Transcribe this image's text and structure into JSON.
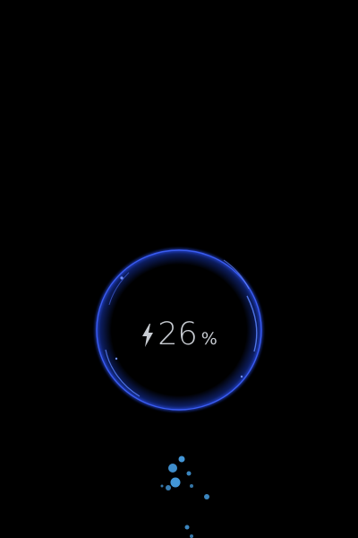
{
  "battery": {
    "level_percent": 26,
    "value_text": "26",
    "unit_text": "%",
    "charging": true,
    "icon": "lightning-bolt-icon"
  },
  "colors": {
    "background": "#000000",
    "ring": "#2a46d6",
    "ring_glow": "#4f74ff",
    "text": "#c8ccd2",
    "bubble": "#4aa6ee"
  }
}
